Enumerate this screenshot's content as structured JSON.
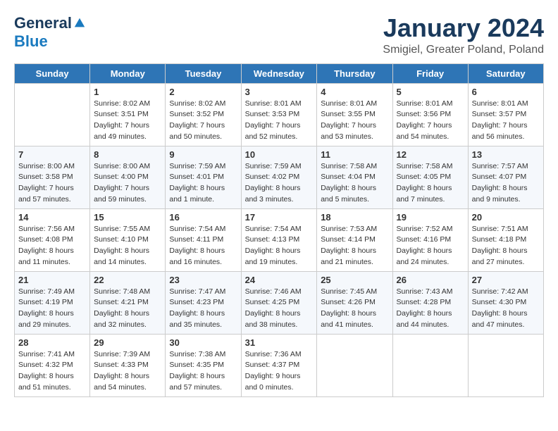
{
  "logo": {
    "general": "General",
    "blue": "Blue"
  },
  "header": {
    "month": "January 2024",
    "location": "Smigiel, Greater Poland, Poland"
  },
  "weekdays": [
    "Sunday",
    "Monday",
    "Tuesday",
    "Wednesday",
    "Thursday",
    "Friday",
    "Saturday"
  ],
  "weeks": [
    [
      {
        "day": "",
        "info": ""
      },
      {
        "day": "1",
        "info": "Sunrise: 8:02 AM\nSunset: 3:51 PM\nDaylight: 7 hours\nand 49 minutes."
      },
      {
        "day": "2",
        "info": "Sunrise: 8:02 AM\nSunset: 3:52 PM\nDaylight: 7 hours\nand 50 minutes."
      },
      {
        "day": "3",
        "info": "Sunrise: 8:01 AM\nSunset: 3:53 PM\nDaylight: 7 hours\nand 52 minutes."
      },
      {
        "day": "4",
        "info": "Sunrise: 8:01 AM\nSunset: 3:55 PM\nDaylight: 7 hours\nand 53 minutes."
      },
      {
        "day": "5",
        "info": "Sunrise: 8:01 AM\nSunset: 3:56 PM\nDaylight: 7 hours\nand 54 minutes."
      },
      {
        "day": "6",
        "info": "Sunrise: 8:01 AM\nSunset: 3:57 PM\nDaylight: 7 hours\nand 56 minutes."
      }
    ],
    [
      {
        "day": "7",
        "info": "Sunrise: 8:00 AM\nSunset: 3:58 PM\nDaylight: 7 hours\nand 57 minutes."
      },
      {
        "day": "8",
        "info": "Sunrise: 8:00 AM\nSunset: 4:00 PM\nDaylight: 7 hours\nand 59 minutes."
      },
      {
        "day": "9",
        "info": "Sunrise: 7:59 AM\nSunset: 4:01 PM\nDaylight: 8 hours\nand 1 minute."
      },
      {
        "day": "10",
        "info": "Sunrise: 7:59 AM\nSunset: 4:02 PM\nDaylight: 8 hours\nand 3 minutes."
      },
      {
        "day": "11",
        "info": "Sunrise: 7:58 AM\nSunset: 4:04 PM\nDaylight: 8 hours\nand 5 minutes."
      },
      {
        "day": "12",
        "info": "Sunrise: 7:58 AM\nSunset: 4:05 PM\nDaylight: 8 hours\nand 7 minutes."
      },
      {
        "day": "13",
        "info": "Sunrise: 7:57 AM\nSunset: 4:07 PM\nDaylight: 8 hours\nand 9 minutes."
      }
    ],
    [
      {
        "day": "14",
        "info": "Sunrise: 7:56 AM\nSunset: 4:08 PM\nDaylight: 8 hours\nand 11 minutes."
      },
      {
        "day": "15",
        "info": "Sunrise: 7:55 AM\nSunset: 4:10 PM\nDaylight: 8 hours\nand 14 minutes."
      },
      {
        "day": "16",
        "info": "Sunrise: 7:54 AM\nSunset: 4:11 PM\nDaylight: 8 hours\nand 16 minutes."
      },
      {
        "day": "17",
        "info": "Sunrise: 7:54 AM\nSunset: 4:13 PM\nDaylight: 8 hours\nand 19 minutes."
      },
      {
        "day": "18",
        "info": "Sunrise: 7:53 AM\nSunset: 4:14 PM\nDaylight: 8 hours\nand 21 minutes."
      },
      {
        "day": "19",
        "info": "Sunrise: 7:52 AM\nSunset: 4:16 PM\nDaylight: 8 hours\nand 24 minutes."
      },
      {
        "day": "20",
        "info": "Sunrise: 7:51 AM\nSunset: 4:18 PM\nDaylight: 8 hours\nand 27 minutes."
      }
    ],
    [
      {
        "day": "21",
        "info": "Sunrise: 7:49 AM\nSunset: 4:19 PM\nDaylight: 8 hours\nand 29 minutes."
      },
      {
        "day": "22",
        "info": "Sunrise: 7:48 AM\nSunset: 4:21 PM\nDaylight: 8 hours\nand 32 minutes."
      },
      {
        "day": "23",
        "info": "Sunrise: 7:47 AM\nSunset: 4:23 PM\nDaylight: 8 hours\nand 35 minutes."
      },
      {
        "day": "24",
        "info": "Sunrise: 7:46 AM\nSunset: 4:25 PM\nDaylight: 8 hours\nand 38 minutes."
      },
      {
        "day": "25",
        "info": "Sunrise: 7:45 AM\nSunset: 4:26 PM\nDaylight: 8 hours\nand 41 minutes."
      },
      {
        "day": "26",
        "info": "Sunrise: 7:43 AM\nSunset: 4:28 PM\nDaylight: 8 hours\nand 44 minutes."
      },
      {
        "day": "27",
        "info": "Sunrise: 7:42 AM\nSunset: 4:30 PM\nDaylight: 8 hours\nand 47 minutes."
      }
    ],
    [
      {
        "day": "28",
        "info": "Sunrise: 7:41 AM\nSunset: 4:32 PM\nDaylight: 8 hours\nand 51 minutes."
      },
      {
        "day": "29",
        "info": "Sunrise: 7:39 AM\nSunset: 4:33 PM\nDaylight: 8 hours\nand 54 minutes."
      },
      {
        "day": "30",
        "info": "Sunrise: 7:38 AM\nSunset: 4:35 PM\nDaylight: 8 hours\nand 57 minutes."
      },
      {
        "day": "31",
        "info": "Sunrise: 7:36 AM\nSunset: 4:37 PM\nDaylight: 9 hours\nand 0 minutes."
      },
      {
        "day": "",
        "info": ""
      },
      {
        "day": "",
        "info": ""
      },
      {
        "day": "",
        "info": ""
      }
    ]
  ]
}
